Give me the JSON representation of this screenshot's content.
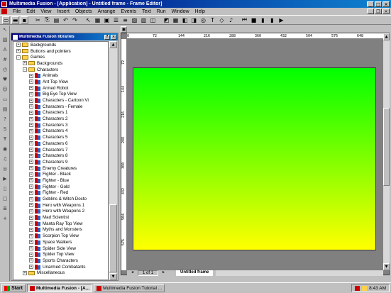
{
  "window": {
    "title": "Multimedia Fusion - [Application] - Untitled frame - Frame Editor]"
  },
  "menu": [
    "File",
    "Edit",
    "View",
    "Insert",
    "Objects",
    "Arrange",
    "Events",
    "Text",
    "Run",
    "Window",
    "Help"
  ],
  "library": {
    "title": "Multimedia Fusion libraries",
    "tree": [
      {
        "label": "Backgrounds",
        "level": 1,
        "type": "folder",
        "expander": "+"
      },
      {
        "label": "Buttons and pointers",
        "level": 1,
        "type": "folder",
        "expander": "+"
      },
      {
        "label": "Games",
        "level": 1,
        "type": "folder",
        "expander": "−"
      },
      {
        "label": "Backgrounds",
        "level": 2,
        "type": "folder",
        "expander": "+"
      },
      {
        "label": "Characters",
        "level": 2,
        "type": "folder",
        "expander": "−"
      },
      {
        "label": "Animals",
        "level": 3,
        "type": "item",
        "expander": "+"
      },
      {
        "label": "Ant Top View",
        "level": 3,
        "type": "item",
        "expander": "+"
      },
      {
        "label": "Armed Robot",
        "level": 3,
        "type": "item",
        "expander": "+"
      },
      {
        "label": "Big Eye Top View",
        "level": 3,
        "type": "item",
        "expander": "+"
      },
      {
        "label": "Characters - Cartoon Vi",
        "level": 3,
        "type": "item",
        "expander": "+"
      },
      {
        "label": "Characters - Female",
        "level": 3,
        "type": "item",
        "expander": "+"
      },
      {
        "label": "Characters 1",
        "level": 3,
        "type": "item",
        "expander": "+"
      },
      {
        "label": "Characters 2",
        "level": 3,
        "type": "item",
        "expander": "+"
      },
      {
        "label": "Characters 3",
        "level": 3,
        "type": "item",
        "expander": "+"
      },
      {
        "label": "Characters 4",
        "level": 3,
        "type": "item",
        "expander": "+"
      },
      {
        "label": "Characters 5",
        "level": 3,
        "type": "item",
        "expander": "+"
      },
      {
        "label": "Characters 6",
        "level": 3,
        "type": "item",
        "expander": "+"
      },
      {
        "label": "Characters 7",
        "level": 3,
        "type": "item",
        "expander": "+"
      },
      {
        "label": "Characters 8",
        "level": 3,
        "type": "item",
        "expander": "+"
      },
      {
        "label": "Characters 9",
        "level": 3,
        "type": "item",
        "expander": "+"
      },
      {
        "label": "Enemy Creatures",
        "level": 3,
        "type": "item",
        "expander": "+"
      },
      {
        "label": "Fighter - Black",
        "level": 3,
        "type": "item",
        "expander": "+"
      },
      {
        "label": "Fighter - Blue",
        "level": 3,
        "type": "item",
        "expander": "+"
      },
      {
        "label": "Fighter - Gold",
        "level": 3,
        "type": "item",
        "expander": "+"
      },
      {
        "label": "Fighter - Red",
        "level": 3,
        "type": "item",
        "expander": "+"
      },
      {
        "label": "Goblins & Witch Docto",
        "level": 3,
        "type": "item",
        "expander": "+"
      },
      {
        "label": "Hero with Weapons 1",
        "level": 3,
        "type": "item",
        "expander": "+"
      },
      {
        "label": "Hero with Weapons 2",
        "level": 3,
        "type": "item",
        "expander": "+"
      },
      {
        "label": "Mad Scientist",
        "level": 3,
        "type": "item",
        "expander": "+"
      },
      {
        "label": "Manta Ray Top View",
        "level": 3,
        "type": "item",
        "expander": "+"
      },
      {
        "label": "Myths and Monsters",
        "level": 3,
        "type": "item",
        "expander": "+"
      },
      {
        "label": "Scorpion Top View",
        "level": 3,
        "type": "item",
        "expander": "+"
      },
      {
        "label": "Space Walkers",
        "level": 3,
        "type": "item",
        "expander": "+"
      },
      {
        "label": "Spider Side View",
        "level": 3,
        "type": "item",
        "expander": "+"
      },
      {
        "label": "Spider Top View",
        "level": 3,
        "type": "item",
        "expander": "+"
      },
      {
        "label": "Sports Characters",
        "level": 3,
        "type": "item",
        "expander": "+"
      },
      {
        "label": "Unarmed Combatants",
        "level": 3,
        "type": "item",
        "expander": "+"
      },
      {
        "label": "Miscellaneous",
        "level": 2,
        "type": "folder",
        "expander": "+"
      }
    ]
  },
  "rulers": {
    "horizontal": [
      "0",
      "72",
      "144",
      "216",
      "288",
      "360",
      "432",
      "504",
      "576",
      "648"
    ],
    "vertical": [
      "72",
      "144",
      "216",
      "288",
      "360",
      "432",
      "504",
      "576"
    ]
  },
  "editor": {
    "page_indicator": "1 of 1",
    "frame_tab": "Untitled frame",
    "canvas_gradient_top": "#00ff00",
    "canvas_gradient_bottom": "#ffff00"
  },
  "taskbar": {
    "start_label": "Start",
    "tasks": [
      {
        "label": "Multimedia Fusion - [A...",
        "active": true
      },
      {
        "label": "Multimedia Fusion Tutorial ...",
        "active": false
      }
    ],
    "clock": "8:43 AM"
  }
}
